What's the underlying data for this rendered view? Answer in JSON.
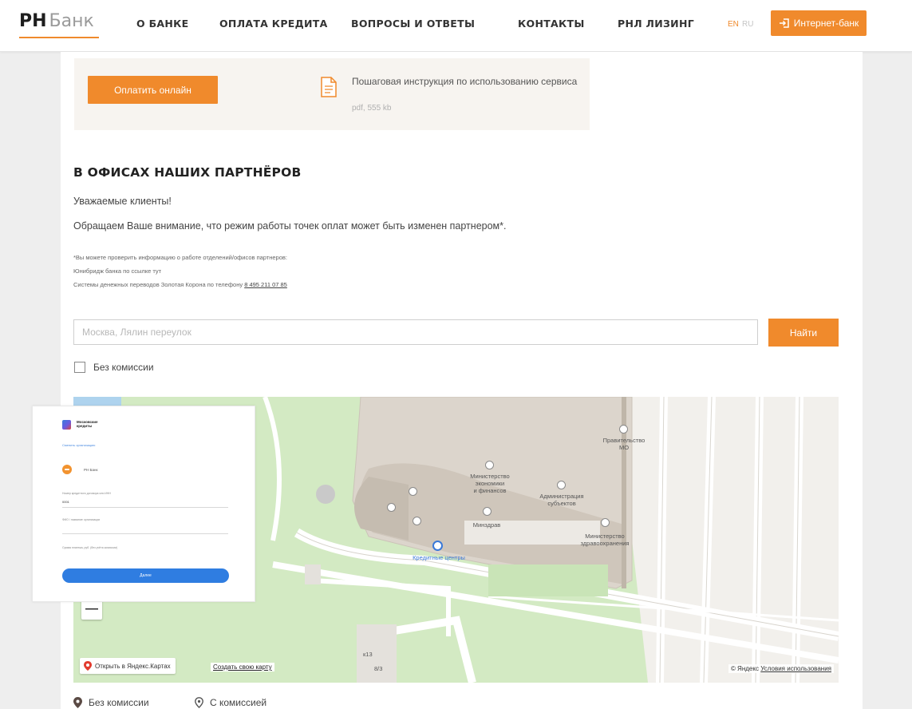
{
  "header": {
    "logo_primary": "РН",
    "logo_secondary": "Банк",
    "nav": [
      {
        "label": "О БАНКЕ"
      },
      {
        "label": "ОПЛАТА КРЕДИТА"
      },
      {
        "label": "ВОПРОСЫ И ОТВЕТЫ"
      },
      {
        "label": "КОНТАКТЫ"
      },
      {
        "label": "РНЛ ЛИЗИНГ"
      }
    ],
    "lang_en": "EN",
    "lang_ru": "RU",
    "internet_bank_label": "Интернет-банк"
  },
  "payment": {
    "pay_online_label": "Оплатить онлайн",
    "instruction_text": "Пошаговая инструкция по использованию сервиса",
    "instruction_size": "pdf, 555 kb"
  },
  "partners": {
    "title": "В ОФИСАХ НАШИХ ПАРТНЁРОВ",
    "greeting": "Уважаемые клиенты!",
    "notice": "Обращаем Ваше внимание, что режим работы точек оплат может быть изменен партнером*.",
    "footnote_1": "*Вы можете проверить информацию о работе отделений/офисов партнеров:",
    "footnote_2": "Юнибридж банка по ссылке тут",
    "footnote_3_prefix": "Системы денежных переводов Золотая Корона по телефону",
    "footnote_3_phone": "8 495 211 07 85"
  },
  "search": {
    "placeholder": "Москва, Лялин переулок",
    "button_label": "Найти",
    "no_commission_label": "Без комиссии",
    "no_commission_checked": false
  },
  "map": {
    "pois": [
      {
        "label": "Правительство\nМО"
      },
      {
        "label": "Министерство\nэкономики\nи финансов"
      },
      {
        "label": "Администрация\nсубъектов"
      },
      {
        "label": "Минздрав"
      },
      {
        "label": "Министерство\nздравоохранения"
      },
      {
        "label": "Кредитные центры"
      }
    ],
    "house_numbers": [
      "к13",
      "8/3"
    ],
    "zoom_label": "—",
    "open_in_yandex": "Открыть в Яндекс.Картах",
    "create_map": "Создать свою карту",
    "copyright": "© Яндекс",
    "terms": "Условия использования"
  },
  "legend": {
    "no_commission": "Без комиссии",
    "with_commission": "С комиссией"
  },
  "popup": {
    "brand_line1": "Московские",
    "brand_line2": "кредиты",
    "link": "Сменить организацию",
    "bank_name": "РН Банк",
    "field1_label": "Номер кредитного договора или ИНН",
    "field1_value": "0001",
    "field2_label": "ФИО / название организации",
    "field3_label": "Сумма платежа, руб. (без учёта комиссии)",
    "submit_label": "Далее"
  },
  "colors": {
    "accent": "#f08a2c",
    "popup_button": "#2f7de1"
  }
}
